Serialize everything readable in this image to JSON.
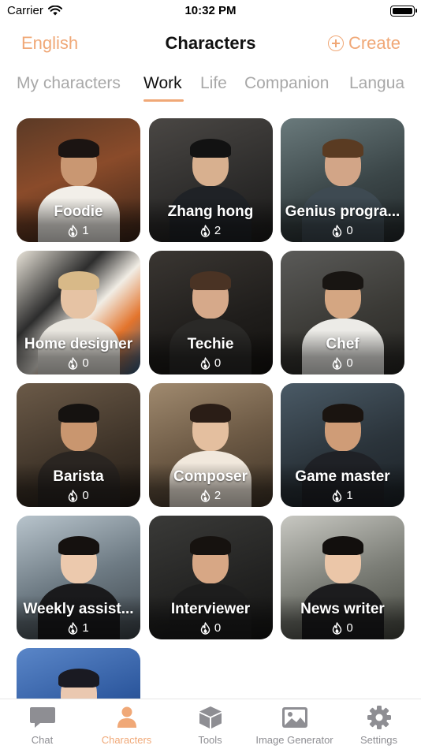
{
  "status_bar": {
    "carrier": "Carrier",
    "time": "10:32 PM"
  },
  "nav": {
    "language": "English",
    "title": "Characters",
    "create_label": "Create"
  },
  "tabs": [
    {
      "label": "My characters",
      "active": false
    },
    {
      "label": "Work",
      "active": true
    },
    {
      "label": "Life",
      "active": false
    },
    {
      "label": "Companion",
      "active": false
    },
    {
      "label": "Langua",
      "active": false
    }
  ],
  "characters": [
    {
      "name": "Foodie",
      "count": "1",
      "theme": "foodie"
    },
    {
      "name": "Zhang hong",
      "count": "2",
      "theme": "suit"
    },
    {
      "name": "Genius progra...",
      "count": "0",
      "theme": "programmer"
    },
    {
      "name": "Home designer",
      "count": "0",
      "theme": "designer"
    },
    {
      "name": "Techie",
      "count": "0",
      "theme": "techie"
    },
    {
      "name": "Chef",
      "count": "0",
      "theme": "chef"
    },
    {
      "name": "Barista",
      "count": "0",
      "theme": "barista"
    },
    {
      "name": "Composer",
      "count": "2",
      "theme": "composer"
    },
    {
      "name": "Game master",
      "count": "1",
      "theme": "gamer"
    },
    {
      "name": "Weekly assist...",
      "count": "1",
      "theme": "assistant"
    },
    {
      "name": "Interviewer",
      "count": "0",
      "theme": "interviewer"
    },
    {
      "name": "News writer",
      "count": "0",
      "theme": "writer"
    },
    {
      "name": "",
      "count": "",
      "theme": "partial"
    }
  ],
  "tab_bar": [
    {
      "label": "Chat",
      "icon": "chat-bubble-icon",
      "active": false
    },
    {
      "label": "Characters",
      "icon": "person-icon",
      "active": true
    },
    {
      "label": "Tools",
      "icon": "box-icon",
      "active": false
    },
    {
      "label": "Image Generator",
      "icon": "image-icon",
      "active": false
    },
    {
      "label": "Settings",
      "icon": "gear-icon",
      "active": false
    }
  ],
  "colors": {
    "accent": "#f0a877",
    "inactive": "#8e8e93"
  }
}
